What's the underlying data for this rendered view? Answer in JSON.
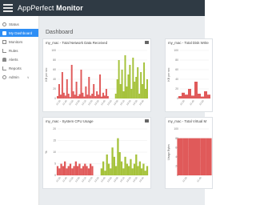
{
  "app": {
    "title_light": "AppPerfect ",
    "title_bold": "Monitor"
  },
  "sidebar": {
    "items": [
      {
        "label": "Status",
        "icon": "status-icon"
      },
      {
        "label": "My Dashboard",
        "icon": "dashboard-icon",
        "active": true
      },
      {
        "label": "Monitors",
        "icon": "monitors-icon"
      },
      {
        "label": "Rules",
        "icon": "rules-icon"
      },
      {
        "label": "Alerts",
        "icon": "alerts-icon"
      },
      {
        "label": "Reports",
        "icon": "reports-icon"
      },
      {
        "label": "Admin",
        "icon": "admin-icon",
        "chevron": "∨"
      }
    ]
  },
  "main": {
    "page_title": "Dashboard"
  },
  "colors": {
    "accent": "#2e8ef5",
    "topbar": "#2f3a44",
    "red_series": "#e05a5a",
    "green_series": "#a5c23a"
  },
  "chart_data": [
    {
      "type": "area",
      "title": "my_mac - Total Network Data Received",
      "ylabel": "KB per sec",
      "ylim": [
        0,
        100
      ],
      "yticks": [
        "100",
        "80",
        "60",
        "40",
        "20",
        "0"
      ],
      "series": [
        {
          "color": "#e05a5a",
          "values": [
            5,
            30,
            8,
            55,
            12,
            6,
            40,
            10,
            3,
            70,
            15,
            8,
            35,
            5,
            9,
            60,
            12,
            4,
            25,
            8,
            45,
            6,
            10,
            30,
            5,
            15,
            8,
            50,
            4,
            12,
            6,
            20,
            5
          ]
        },
        {
          "color": "#a5c23a",
          "values": [
            0,
            0,
            0,
            0,
            0,
            0,
            0,
            0,
            0,
            0,
            0,
            0,
            0,
            0,
            0,
            0,
            0,
            0,
            0,
            0,
            0,
            0,
            0,
            0,
            0,
            0,
            0,
            0,
            0,
            0,
            0,
            0,
            0,
            0,
            0,
            0,
            0,
            10,
            40,
            80,
            30,
            60,
            15,
            90,
            25,
            50,
            70,
            20,
            85,
            35,
            45,
            65,
            10,
            55,
            30,
            75,
            20,
            40
          ]
        }
      ],
      "xticks": [
        "11:30",
        "11:40",
        "11:50",
        "12:00",
        "12:10",
        "12:20",
        "12:30",
        "12:40",
        "12:50",
        "13:00",
        "13:10",
        "13:20",
        "13:30",
        "13:40"
      ]
    },
    {
      "type": "area",
      "title": "my_mac - Total Disk Write",
      "ylabel": "KB per sec",
      "ylim": [
        0,
        100
      ],
      "yticks": [
        "100",
        "80",
        "60",
        "40",
        "20",
        "0"
      ],
      "series": [
        {
          "color": "#e05a5a",
          "values": [
            5,
            12,
            8,
            20,
            6,
            35,
            10,
            4,
            15,
            8
          ]
        }
      ],
      "xticks": [
        "11:30",
        "11:40",
        "11:50"
      ]
    },
    {
      "type": "area",
      "title": "my_mac - System CPU Usage",
      "ylabel": "%",
      "ylim": [
        0,
        20
      ],
      "yticks": [
        "20",
        "15",
        "10",
        "5",
        "0"
      ],
      "series": [
        {
          "color": "#e05a5a",
          "values": [
            4,
            3,
            5,
            4,
            6,
            3,
            4,
            5,
            3,
            4,
            6,
            4,
            5,
            3,
            4,
            5,
            4,
            3,
            5,
            4
          ]
        },
        {
          "color": "#a5c23a",
          "values": [
            0,
            0,
            0,
            0,
            0,
            0,
            0,
            0,
            0,
            0,
            0,
            0,
            0,
            0,
            0,
            0,
            0,
            0,
            0,
            0,
            0,
            0,
            0,
            0,
            3,
            6,
            2,
            9,
            5,
            3,
            12,
            8,
            4,
            16,
            10,
            6,
            3,
            8,
            5,
            4,
            7,
            3,
            5,
            9,
            4,
            6,
            3,
            5,
            2,
            4
          ]
        }
      ],
      "xticks": [
        "11:30",
        "11:40",
        "11:50",
        "12:00",
        "12:10",
        "12:20",
        "12:30",
        "12:40",
        "12:50",
        "13:00",
        "13:10",
        "13:20",
        "13:30",
        "13:40"
      ]
    },
    {
      "type": "area",
      "title": "my_mac - Total Virtual M",
      "ylabel": "Usage Bytes",
      "ylim": [
        0,
        100
      ],
      "yticks": [
        "100",
        "80",
        "60",
        "40",
        "20",
        "0"
      ],
      "series": [
        {
          "color": "#e05a5a",
          "values": [
            80,
            80,
            80,
            80,
            80,
            80
          ]
        }
      ],
      "xticks": [
        "11:30",
        "11:40"
      ]
    }
  ]
}
